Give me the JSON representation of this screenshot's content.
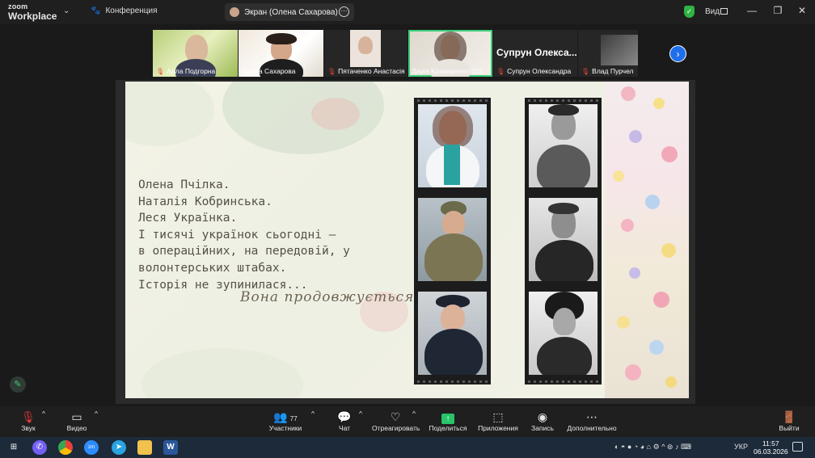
{
  "titlebar": {
    "app_line1": "zoom",
    "app_line2": "Workplace",
    "conference_label": "Конференция",
    "share_label": "Экран (Олена Сахарова)",
    "view_label": "Вид"
  },
  "participants": [
    {
      "name": "Алла Подгорна",
      "muted": true
    },
    {
      "name": "Олена Сахарова",
      "muted": false
    },
    {
      "name": "Пятаченко Анастасія",
      "muted": true
    },
    {
      "name": "Дарія Крамаренко 315",
      "muted": false
    },
    {
      "name": "Супрун Олександра",
      "muted": true,
      "big_label": "Супрун  Олекса..."
    },
    {
      "name": "Влад Пурчел",
      "muted": true
    }
  ],
  "slide": {
    "lines": [
      "Олена Пчілка.",
      "Наталія Кобринська.",
      "Леся Українка.",
      "І тисячі українок сьогодні —",
      "в операційних, на передовій, у",
      "волонтерських штабах.",
      "Історія не зупинилася..."
    ],
    "script_line": "Вона продовжується."
  },
  "toolbar": {
    "audio": "Звук",
    "video": "Видео",
    "participants": "Участники",
    "participants_count": "77",
    "chat": "Чат",
    "react": "Отреагировать",
    "share": "Поделиться",
    "apps": "Приложения",
    "record": "Запись",
    "more": "Дополнительно",
    "leave": "Выйти"
  },
  "taskbar": {
    "lang": "УКР",
    "time": "11:57",
    "date": "06.03.2026"
  },
  "colors": {
    "accent_green": "#27c46a",
    "active_outline": "#3ccf7a",
    "next_blue": "#1f6feb",
    "leave_red": "#e53935"
  }
}
